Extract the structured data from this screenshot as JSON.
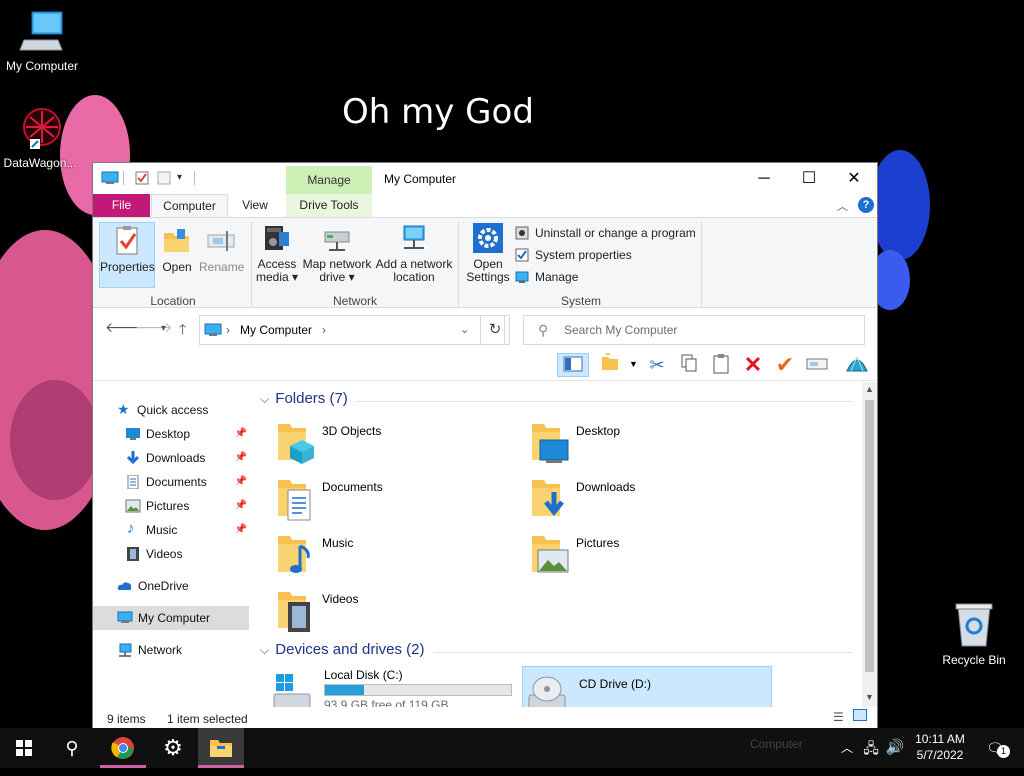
{
  "desktop": {
    "wallpaper_text": "Oh my God",
    "icons": {
      "my_computer": "My Computer",
      "datawagon": "DataWagon...",
      "recycle_bin": "Recycle Bin"
    }
  },
  "window": {
    "title": "My Computer",
    "context_tab_group": "Manage",
    "tabs": {
      "file": "File",
      "computer": "Computer",
      "view": "View",
      "drive_tools": "Drive Tools"
    },
    "ribbon": {
      "location": {
        "label": "Location",
        "properties": "Properties",
        "open": "Open",
        "rename": "Rename"
      },
      "network": {
        "label": "Network",
        "access_media": [
          "Access",
          "media ▾"
        ],
        "map_drive": [
          "Map network",
          "drive ▾"
        ],
        "add_location": [
          "Add a network",
          "location"
        ]
      },
      "system": {
        "label": "System",
        "open_settings": [
          "Open",
          "Settings"
        ],
        "uninstall": "Uninstall or change a program",
        "system_properties": "System properties",
        "manage": "Manage"
      }
    },
    "address": {
      "path": "My Computer",
      "search_placeholder": "Search My Computer"
    },
    "nav_pane": {
      "quick_access": "Quick access",
      "desktop": "Desktop",
      "downloads": "Downloads",
      "documents": "Documents",
      "pictures": "Pictures",
      "music": "Music",
      "videos": "Videos",
      "onedrive": "OneDrive",
      "my_computer": "My Computer",
      "network": "Network"
    },
    "content": {
      "folders_header": "Folders (7)",
      "folders": {
        "objects3d": "3D Objects",
        "desktop": "Desktop",
        "documents": "Documents",
        "downloads": "Downloads",
        "music": "Music",
        "pictures": "Pictures",
        "videos": "Videos"
      },
      "drives_header": "Devices and drives (2)",
      "drives": {
        "local_disk": {
          "name": "Local Disk (C:)",
          "free": "93.9 GB free of 119 GB",
          "used_fraction": 0.21
        },
        "cd_drive": {
          "name": "CD Drive (D:)"
        }
      }
    },
    "status": {
      "count": "9 items",
      "selected": "1 item selected"
    }
  },
  "taskbar": {
    "time": "10:11 AM",
    "date": "5/7/2022",
    "ghost_label": "Computer",
    "notification_count": "1"
  },
  "colors": {
    "file_tab": "#c2187a",
    "accent_blue": "#0078d7",
    "manage_tab": "#cdf0b6",
    "selection": "#cce8ff"
  }
}
